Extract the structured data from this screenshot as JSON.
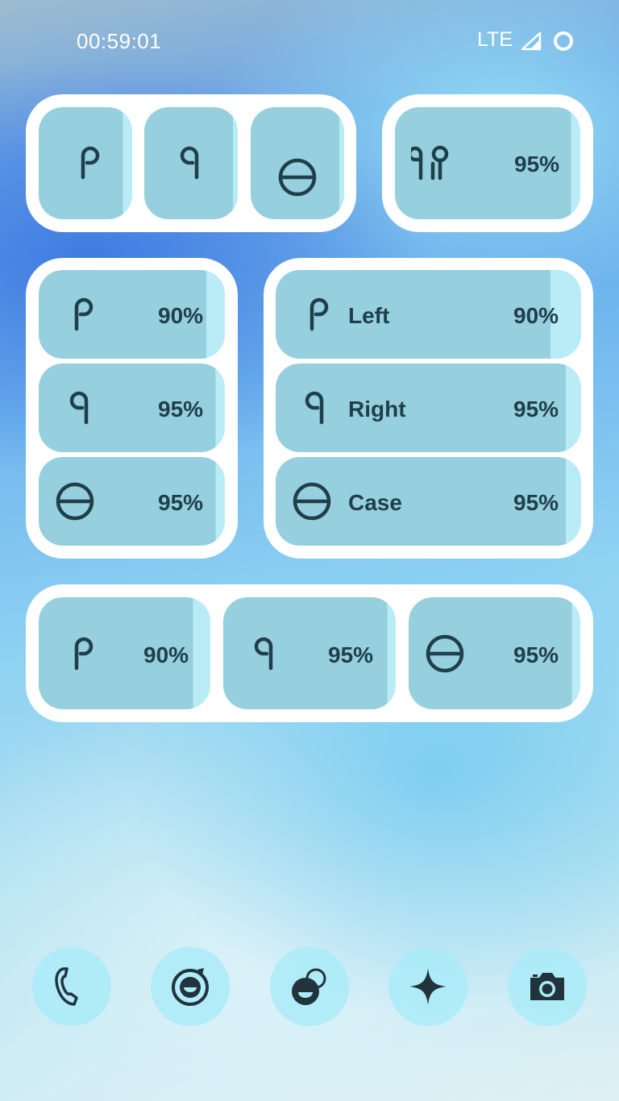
{
  "status": {
    "time": "00:59:01",
    "network": "LTE"
  },
  "widgets": {
    "compact": {
      "left_icon": "left-earbud-icon",
      "right_icon": "right-earbud-icon",
      "case_icon": "case-icon",
      "left_level": 90,
      "right_level": 95,
      "case_level": 95
    },
    "combined": {
      "icon": "earbuds-pair-icon",
      "percent": "95%",
      "level": 95
    },
    "list": {
      "left": {
        "icon": "left-earbud-icon",
        "percent": "90%",
        "level": 90
      },
      "right": {
        "icon": "right-earbud-icon",
        "percent": "95%",
        "level": 95
      },
      "case": {
        "icon": "case-icon",
        "percent": "95%",
        "level": 95
      }
    },
    "labeled": {
      "left": {
        "icon": "left-earbud-icon",
        "name": "Left",
        "percent": "90%",
        "level": 90
      },
      "right": {
        "icon": "right-earbud-icon",
        "name": "Right",
        "percent": "95%",
        "level": 95
      },
      "case": {
        "icon": "case-icon",
        "name": "Case",
        "percent": "95%",
        "level": 95
      }
    },
    "row": {
      "left": {
        "icon": "left-earbud-icon",
        "percent": "90%",
        "level": 90
      },
      "right": {
        "icon": "right-earbud-icon",
        "percent": "95%",
        "level": 95
      },
      "case": {
        "icon": "case-icon",
        "percent": "95%",
        "level": 95
      }
    }
  },
  "dock": {
    "items": [
      {
        "icon": "phone-icon"
      },
      {
        "icon": "messages-icon"
      },
      {
        "icon": "chat-bubbles-icon"
      },
      {
        "icon": "sparkle-icon"
      },
      {
        "icon": "camera-icon"
      }
    ]
  },
  "colors": {
    "tile": "#96cfdd",
    "tile_empty": "#b9ecf6",
    "widget_frame": "#ffffff",
    "icon_ink": "#1f3f4a",
    "dock_bubble": "#aaebf8"
  }
}
